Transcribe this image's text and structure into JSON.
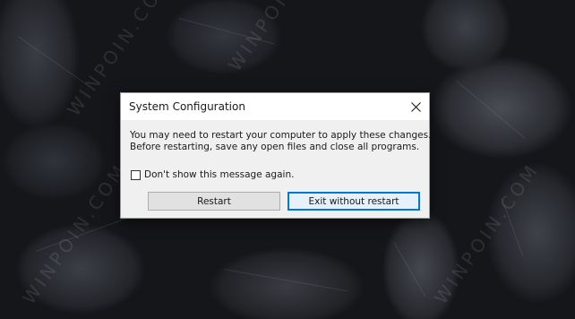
{
  "desktop": {
    "watermark_text": "WINPOIN.COM"
  },
  "dialog": {
    "title": "System Configuration",
    "close_glyph": "×",
    "message_line1": "You may need to restart your computer to apply these changes.",
    "message_line2": "Before restarting, save any open files and close all programs.",
    "checkbox_label": "Don't show this message again.",
    "checkbox_checked": false,
    "restart_label": "Restart",
    "exit_label": "Exit without restart",
    "default_button_color": "#0078d7"
  },
  "icons": {
    "close": "close-icon"
  }
}
